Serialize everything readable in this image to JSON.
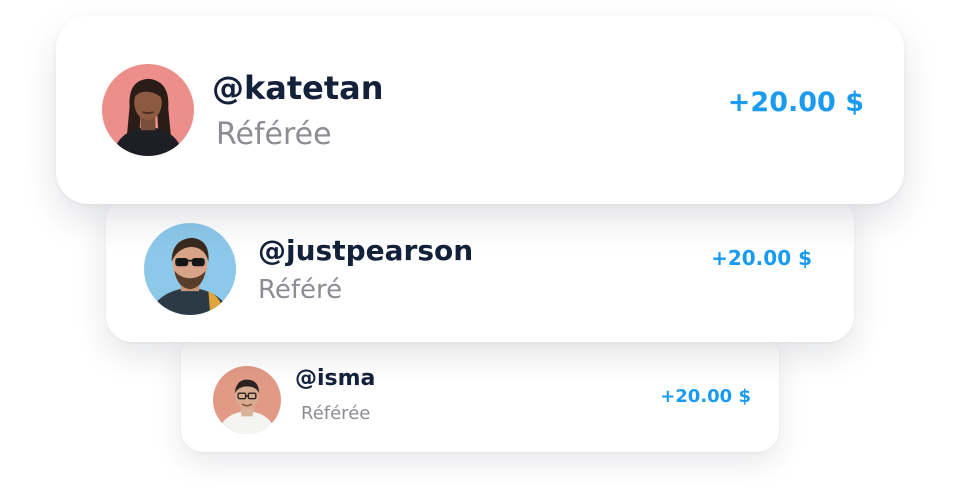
{
  "accent_color": "#1a9bf0",
  "referrals": [
    {
      "handle": "@katetan",
      "status": "Référée",
      "amount": "+20.00 $",
      "avatar_icon": "avatar-woman-icon"
    },
    {
      "handle": "@justpearson",
      "status": "Référé",
      "amount": "+20.00 $",
      "avatar_icon": "avatar-man-sunglasses-icon"
    },
    {
      "handle": "@isma",
      "status": "Référée",
      "amount": "+20.00 $",
      "avatar_icon": "avatar-glasses-icon"
    }
  ]
}
